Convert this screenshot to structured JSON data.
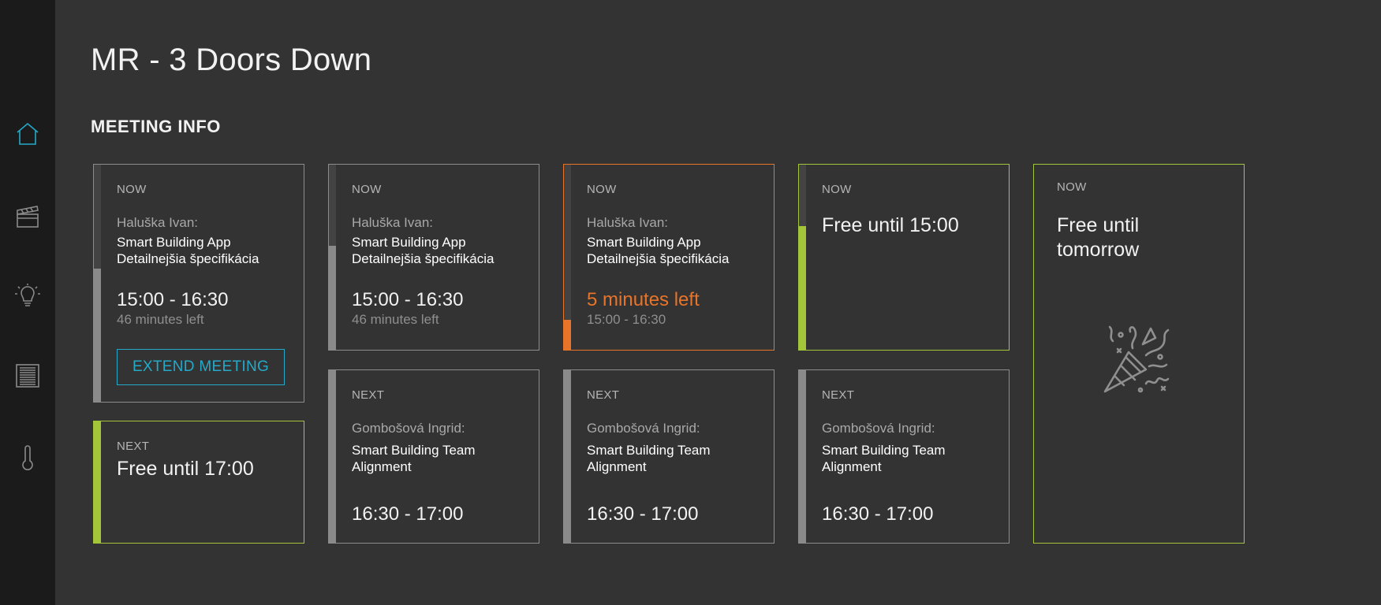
{
  "colors": {
    "accent": "#24a9c9",
    "free": "#a3c53a",
    "warning": "#e8742a",
    "sidebar": "#1b1b1b",
    "background": "#333333"
  },
  "sidebar": {
    "items": [
      {
        "icon": "home-icon",
        "active": true
      },
      {
        "icon": "clapperboard-icon",
        "active": false
      },
      {
        "icon": "lightbulb-icon",
        "active": false
      },
      {
        "icon": "blinds-icon",
        "active": false
      },
      {
        "icon": "thermometer-icon",
        "active": false
      }
    ]
  },
  "page": {
    "title": "MR - 3 Doors Down",
    "section_title": "MEETING INFO"
  },
  "rooms": [
    {
      "now": {
        "label": "NOW",
        "organizer": "Haluška Ivan:",
        "subject": "Smart Building App Detailnejšia špecifikácia",
        "time": "15:00 - 16:30",
        "remaining": "46 minutes left",
        "progress": 0.56,
        "button": "EXTEND MEETING"
      },
      "next": {
        "label": "NEXT",
        "status": "Free until 17:00"
      }
    },
    {
      "now": {
        "label": "NOW",
        "organizer": "Haluška Ivan:",
        "subject": "Smart Building App Detailnejšia špecifikácia",
        "time": "15:00 - 16:30",
        "remaining": "46 minutes left",
        "progress": 0.56
      },
      "next": {
        "label": "NEXT",
        "organizer": "Gombošová Ingrid:",
        "subject": "Smart Building Team Alignment",
        "time": "16:30 - 17:00"
      }
    },
    {
      "now": {
        "label": "NOW",
        "organizer": "Haluška Ivan:",
        "subject": "Smart Building App Detailnejšia špecifikácia",
        "remaining": "5 minutes left",
        "time": "15:00 - 16:30",
        "progress": 0.16
      },
      "next": {
        "label": "NEXT",
        "organizer": "Gombošová Ingrid:",
        "subject": "Smart Building Team Alignment",
        "time": "16:30 - 17:00"
      }
    },
    {
      "now": {
        "label": "NOW",
        "status": "Free until 15:00",
        "progress": 0.67
      },
      "next": {
        "label": "NEXT",
        "organizer": "Gombošová Ingrid:",
        "subject": "Smart Building Team Alignment",
        "time": "16:30 - 17:00"
      }
    },
    {
      "now": {
        "label": "NOW",
        "status": "Free until tomorrow",
        "icon": "party-popper-icon"
      }
    }
  ]
}
